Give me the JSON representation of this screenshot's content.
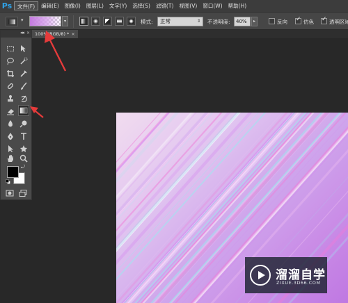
{
  "app": {
    "logo": "Ps",
    "menu": [
      "文件(F)",
      "编辑(E)",
      "图像(I)",
      "图层(L)",
      "文字(Y)",
      "选择(S)",
      "滤镜(T)",
      "视图(V)",
      "窗口(W)",
      "帮助(H)"
    ],
    "active_menu_index": 0
  },
  "options": {
    "mode_label": "模式:",
    "mode_value": "正常",
    "opacity_label": "不透明度:",
    "opacity_value": "40%",
    "reverse_label": "反向",
    "reverse_checked": false,
    "dither_label": "仿色",
    "dither_checked": true,
    "transparency_label": "透明区域",
    "transparency_checked": true,
    "gradient_types": [
      "linear",
      "radial",
      "angle",
      "reflected",
      "diamond"
    ],
    "active_gradient_type": "linear"
  },
  "document": {
    "tab_label": "100%(RGB/8) *",
    "close_glyph": "×"
  },
  "toolbox": {
    "collapse_glyph": "◂◂",
    "close_glyph": "×",
    "tools": [
      "rectangular-marquee-icon",
      "move-icon",
      "lasso-icon",
      "quick-selection-icon",
      "crop-icon",
      "eyedropper-icon",
      "healing-brush-icon",
      "brush-icon",
      "clone-stamp-icon",
      "history-brush-icon",
      "eraser-icon",
      "gradient-icon",
      "blur-icon",
      "dodge-icon",
      "pen-icon",
      "type-icon",
      "path-selection-icon",
      "custom-shape-icon",
      "hand-icon",
      "zoom-icon"
    ],
    "selected_tool": "gradient-icon",
    "foreground_color": "#000000",
    "background_color": "#ffffff"
  },
  "canvas": {
    "background_colors": [
      "#f1dcef",
      "#e2c6f0",
      "#cfa6ec",
      "#c98ae6",
      "#bf78e2"
    ],
    "streak_colors": [
      "#9ee7ef",
      "#f4c6f2",
      "#d586f0",
      "#f07ad8",
      "#ffffff"
    ]
  },
  "annotation": {
    "arrow_color": "#e53b3b"
  },
  "watermark": {
    "title": "溜溜自学",
    "url": "ZIXUE.3D66.COM"
  }
}
